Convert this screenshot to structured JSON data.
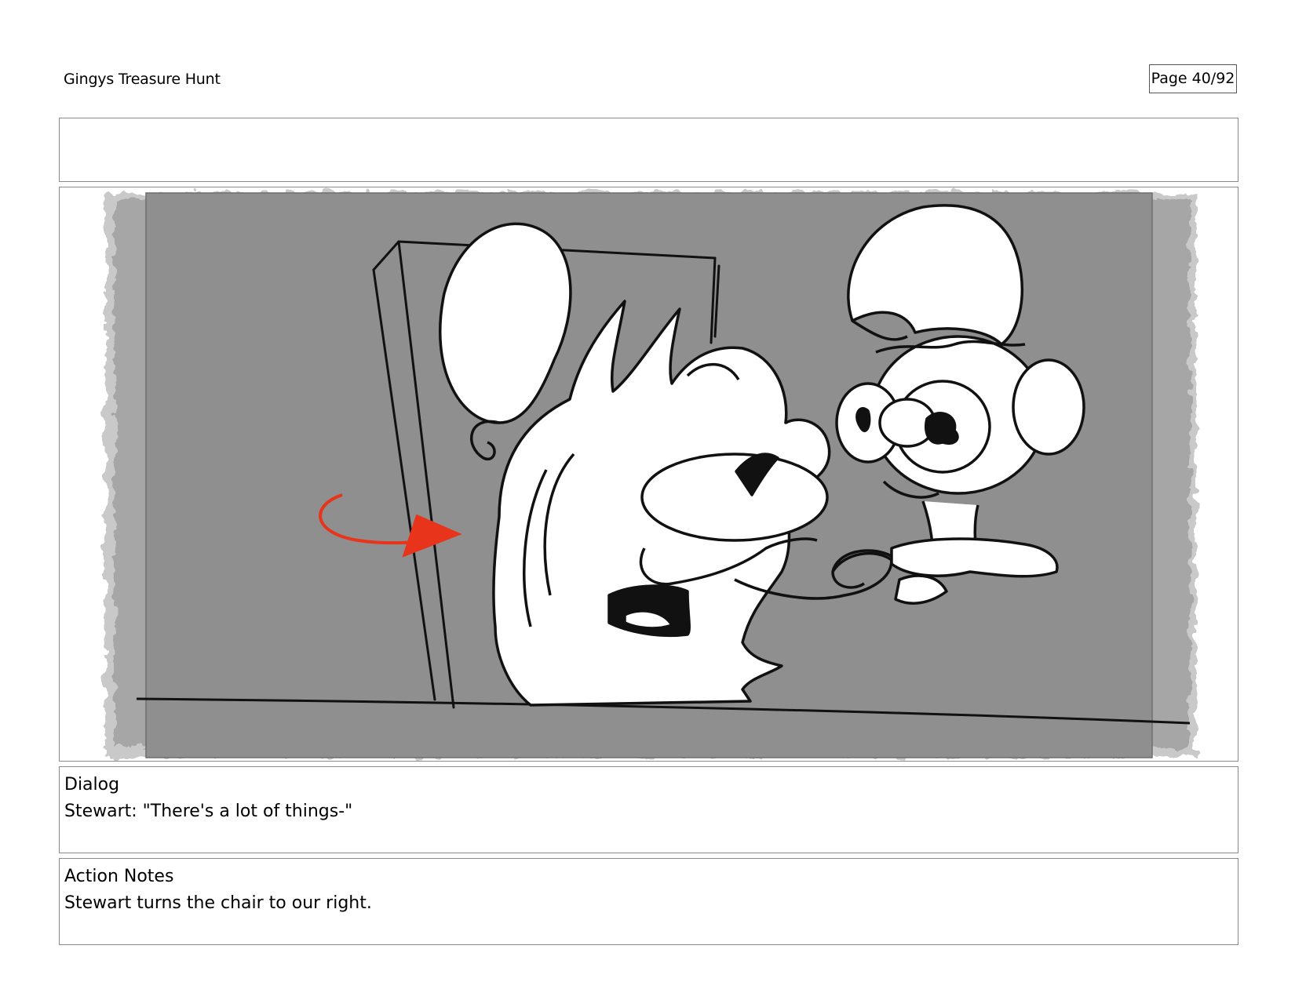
{
  "header": {
    "title": "Gingys Treasure Hunt",
    "page": "Page 40/92"
  },
  "panel": {
    "colors": {
      "background": "#8f8f8f",
      "vignette": "#cfcfcf",
      "ink": "#111111",
      "arrow": "#e8341a"
    }
  },
  "dialog": {
    "heading": "Dialog",
    "text": "Stewart: \"There's a lot of things-\""
  },
  "action_notes": {
    "heading": "Action Notes",
    "text": "Stewart turns the chair to our right."
  }
}
